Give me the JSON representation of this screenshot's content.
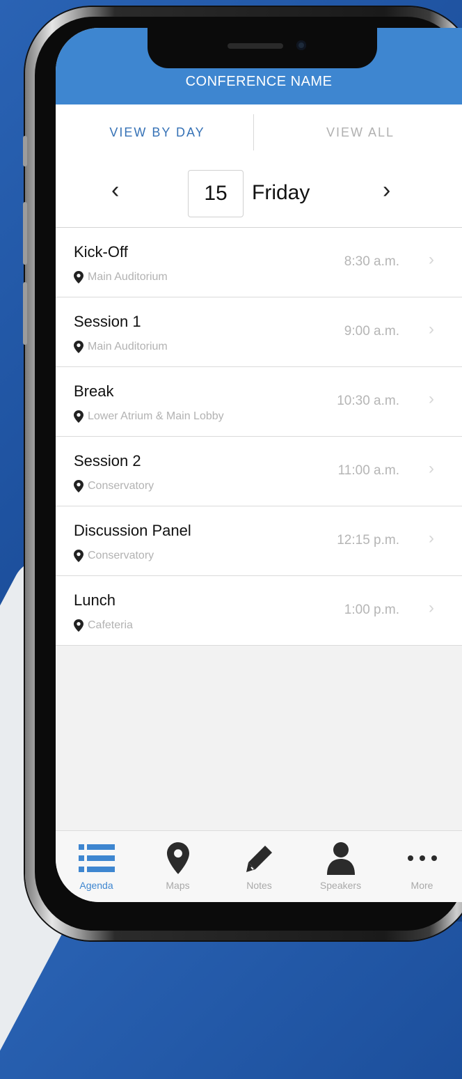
{
  "app": {
    "title": "CONFERENCE NAME"
  },
  "segment": {
    "view_by_day": "VIEW BY DAY",
    "view_all": "VIEW ALL"
  },
  "date": {
    "day_number": "15",
    "day_name": "Friday",
    "prev": "‹",
    "next": "›"
  },
  "sessions": [
    {
      "name": "Kick-Off",
      "location": "Main Auditorium",
      "time": "8:30 a.m."
    },
    {
      "name": "Session 1",
      "location": "Main Auditorium",
      "time": "9:00 a.m."
    },
    {
      "name": "Break",
      "location": "Lower Atrium & Main Lobby",
      "time": "10:30 a.m."
    },
    {
      "name": "Session 2",
      "location": "Conservatory",
      "time": "11:00 a.m."
    },
    {
      "name": "Discussion Panel",
      "location": "Conservatory",
      "time": "12:15 p.m."
    },
    {
      "name": "Lunch",
      "location": "Cafeteria",
      "time": "1:00 p.m."
    }
  ],
  "tabbar": [
    {
      "label": "Agenda",
      "icon": "list-icon",
      "active": true
    },
    {
      "label": "Maps",
      "icon": "map-pin-icon",
      "active": false
    },
    {
      "label": "Notes",
      "icon": "pencil-icon",
      "active": false
    },
    {
      "label": "Speakers",
      "icon": "person-icon",
      "active": false
    },
    {
      "label": "More",
      "icon": "more-dots-icon",
      "active": false
    }
  ],
  "colors": {
    "accent": "#3e86d0",
    "active_text": "#3672b6",
    "muted": "#b5b5b5"
  }
}
